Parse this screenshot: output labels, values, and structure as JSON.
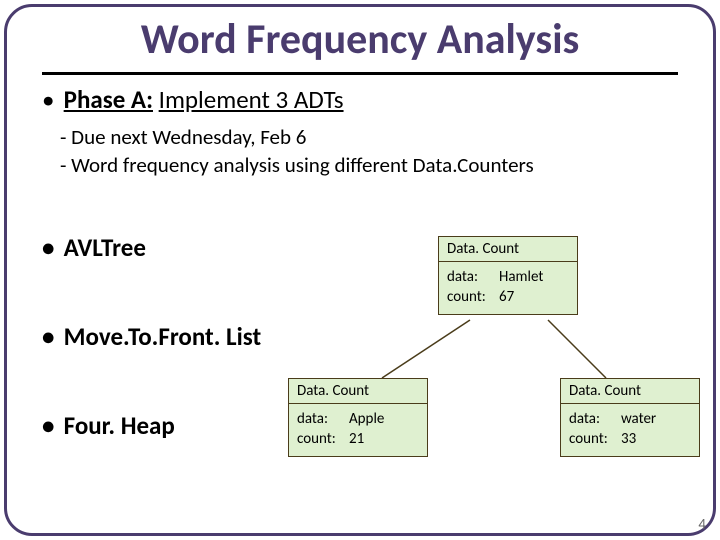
{
  "title": "Word Frequency Analysis",
  "phase": {
    "label": "Phase A:",
    "text": "Implement 3 ADTs"
  },
  "subs": [
    "- Due next Wednesday, Feb 6",
    "- Word frequency analysis using different Data.Counters"
  ],
  "adts": [
    "AVLTree",
    "Move.To.Front. List",
    "Four. Heap"
  ],
  "node_header": "Data. Count",
  "labels": {
    "data": "data:",
    "count": "count:"
  },
  "nodes": {
    "root": {
      "data": "Hamlet",
      "count": "67"
    },
    "left": {
      "data": "Apple",
      "count": "21"
    },
    "right": {
      "data": "water",
      "count": "33"
    }
  },
  "page_number": "4"
}
